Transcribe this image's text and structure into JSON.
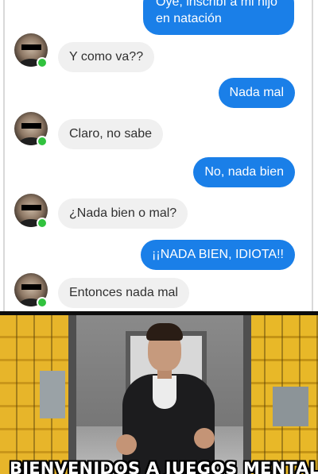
{
  "chat": {
    "messages": [
      {
        "side": "out",
        "text": "Oye, inscribí a mi hijo en natación"
      },
      {
        "side": "in",
        "text": "Y como va??"
      },
      {
        "side": "out",
        "text": "Nada mal"
      },
      {
        "side": "in",
        "text": "Claro, no sabe"
      },
      {
        "side": "out",
        "text": "No, nada bien"
      },
      {
        "side": "in",
        "text": "¿Nada bien o mal?"
      },
      {
        "side": "out",
        "text": "¡¡NADA BIEN, IDIOTA!!"
      },
      {
        "side": "in",
        "text": "Entonces nada mal"
      }
    ],
    "colors": {
      "outgoing_bubble": "#1a7fe8",
      "incoming_bubble": "#f0f0f0",
      "online_dot": "#31c23e"
    }
  },
  "scene": {
    "caption": "BIENVENIDOS A JUEGOS MENTALES",
    "wall_color": "#e7b52a"
  }
}
